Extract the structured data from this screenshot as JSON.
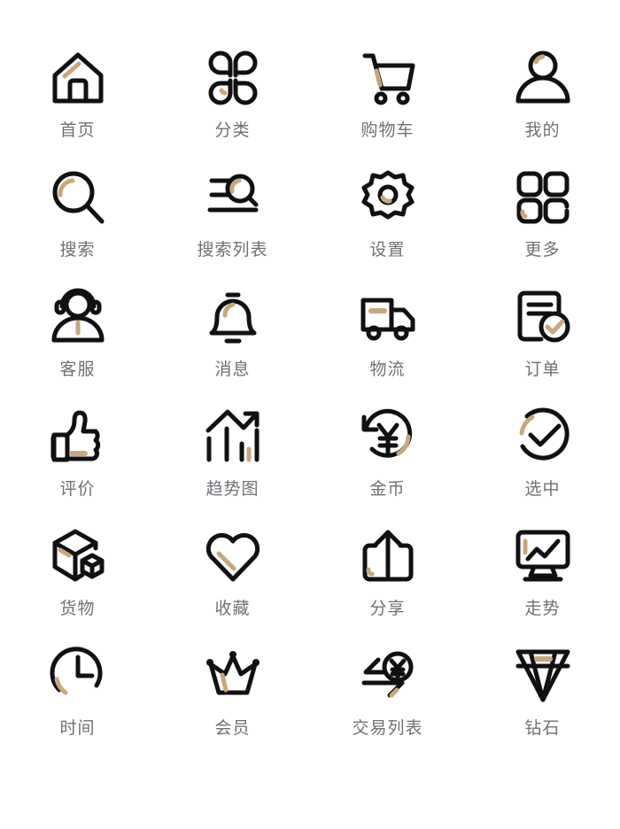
{
  "sheet": {
    "background": "#ffffff",
    "ink_color": "#111111",
    "accent_color": "#c9a77c",
    "label_color": "#6e7175",
    "columns": 4,
    "rows": 6
  },
  "icons": [
    {
      "id": "home",
      "label": "首页",
      "icon_name": "home-icon"
    },
    {
      "id": "category",
      "label": "分类",
      "icon_name": "clover-category-icon"
    },
    {
      "id": "cart",
      "label": "购物车",
      "icon_name": "shopping-cart-icon"
    },
    {
      "id": "profile",
      "label": "我的",
      "icon_name": "user-profile-icon"
    },
    {
      "id": "search",
      "label": "搜索",
      "icon_name": "magnifier-search-icon"
    },
    {
      "id": "search-list",
      "label": "搜索列表",
      "icon_name": "search-list-icon"
    },
    {
      "id": "settings",
      "label": "设置",
      "icon_name": "gear-settings-icon"
    },
    {
      "id": "more",
      "label": "更多",
      "icon_name": "grid-more-icon"
    },
    {
      "id": "support",
      "label": "客服",
      "icon_name": "headset-customer-service-icon"
    },
    {
      "id": "message",
      "label": "消息",
      "icon_name": "bell-notification-icon"
    },
    {
      "id": "logistics",
      "label": "物流",
      "icon_name": "delivery-truck-icon"
    },
    {
      "id": "order",
      "label": "订单",
      "icon_name": "document-check-order-icon"
    },
    {
      "id": "review",
      "label": "评价",
      "icon_name": "thumbs-up-icon"
    },
    {
      "id": "trend-chart",
      "label": "趋势图",
      "icon_name": "bar-chart-arrow-icon"
    },
    {
      "id": "coin",
      "label": "金币",
      "icon_name": "yuan-refund-coin-icon"
    },
    {
      "id": "selected",
      "label": "选中",
      "icon_name": "check-circle-icon"
    },
    {
      "id": "goods",
      "label": "货物",
      "icon_name": "package-box-icon"
    },
    {
      "id": "favorite",
      "label": "收藏",
      "icon_name": "heart-favorite-icon"
    },
    {
      "id": "share",
      "label": "分享",
      "icon_name": "share-upload-icon"
    },
    {
      "id": "market-trend",
      "label": "走势",
      "icon_name": "monitor-line-chart-icon"
    },
    {
      "id": "time",
      "label": "时间",
      "icon_name": "clock-time-icon"
    },
    {
      "id": "member",
      "label": "会员",
      "icon_name": "crown-member-icon"
    },
    {
      "id": "trade-list",
      "label": "交易列表",
      "icon_name": "transaction-list-icon"
    },
    {
      "id": "diamond",
      "label": "钻石",
      "icon_name": "diamond-icon"
    }
  ]
}
